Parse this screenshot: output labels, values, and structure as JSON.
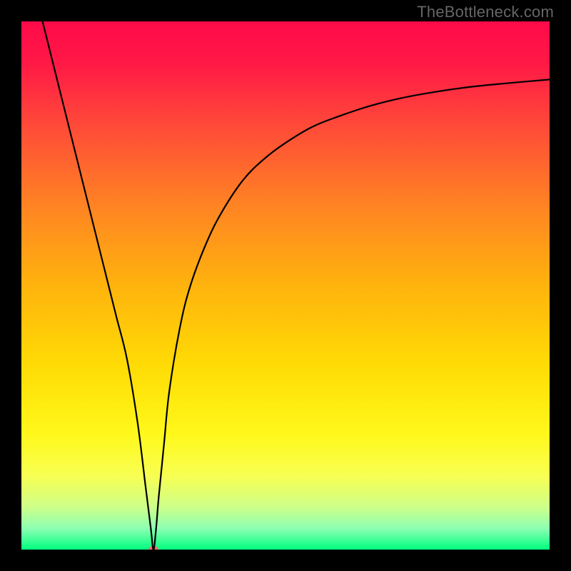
{
  "watermark": "TheBottleneck.com",
  "chart_data": {
    "type": "line",
    "title": "",
    "xlabel": "",
    "ylabel": "",
    "xlim": [
      0,
      100
    ],
    "ylim": [
      0,
      100
    ],
    "grid": false,
    "gradient_stops": [
      {
        "offset": 0.0,
        "color": "#ff0a49"
      },
      {
        "offset": 0.08,
        "color": "#ff1946"
      },
      {
        "offset": 0.2,
        "color": "#ff4b38"
      },
      {
        "offset": 0.35,
        "color": "#ff8423"
      },
      {
        "offset": 0.5,
        "color": "#ffb30d"
      },
      {
        "offset": 0.65,
        "color": "#ffdb05"
      },
      {
        "offset": 0.78,
        "color": "#fff81a"
      },
      {
        "offset": 0.86,
        "color": "#f8ff52"
      },
      {
        "offset": 0.92,
        "color": "#cdff8a"
      },
      {
        "offset": 0.96,
        "color": "#8cffb2"
      },
      {
        "offset": 1.0,
        "color": "#00ff7e"
      }
    ],
    "series": [
      {
        "name": "bottleneck-curve",
        "x": [
          4,
          6,
          8,
          10,
          12,
          14,
          16,
          18,
          20,
          22,
          23.5,
          24.5,
          25,
          25.5,
          26,
          27,
          28,
          30,
          32,
          35,
          38,
          42,
          46,
          50,
          55,
          60,
          66,
          72,
          78,
          85,
          92,
          100
        ],
        "y": [
          100,
          92,
          84,
          76,
          68,
          60,
          52,
          44,
          36,
          24,
          12,
          4,
          0,
          4,
          10,
          20,
          30,
          42,
          50,
          58,
          64,
          70,
          74,
          77,
          80,
          82,
          84,
          85.5,
          86.6,
          87.6,
          88.3,
          89
        ]
      }
    ],
    "marker": {
      "x": 25,
      "y": 0,
      "color": "#ff6b6b",
      "rx": 7,
      "ry": 5
    }
  }
}
